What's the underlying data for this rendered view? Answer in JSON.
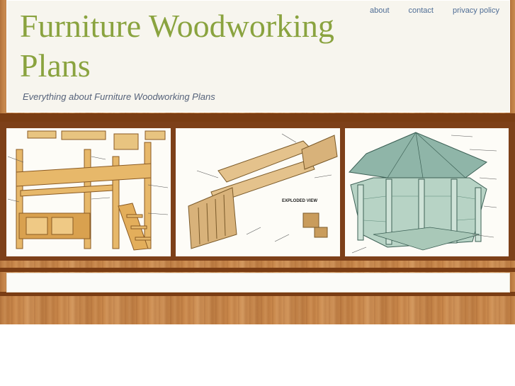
{
  "site": {
    "title": "Furniture Woodworking Plans",
    "tagline": "Everything about Furniture Woodworking Plans"
  },
  "nav": [
    {
      "label": "about"
    },
    {
      "label": "contact"
    },
    {
      "label": "privacy policy"
    }
  ],
  "gallery": [
    {
      "icon": "loft-bed-plan-image",
      "subject": "loft bed plans"
    },
    {
      "icon": "futon-plan-image",
      "subject": "futon exploded view",
      "caption": "EXPLODED VIEW"
    },
    {
      "icon": "gazebo-plan-image",
      "subject": "gazebo plans"
    }
  ],
  "colors": {
    "title": "#8aa33f",
    "tagline": "#55627a",
    "nav_link": "#4f6d95",
    "wood": "#c9874a",
    "frame": "#7a3d14"
  }
}
